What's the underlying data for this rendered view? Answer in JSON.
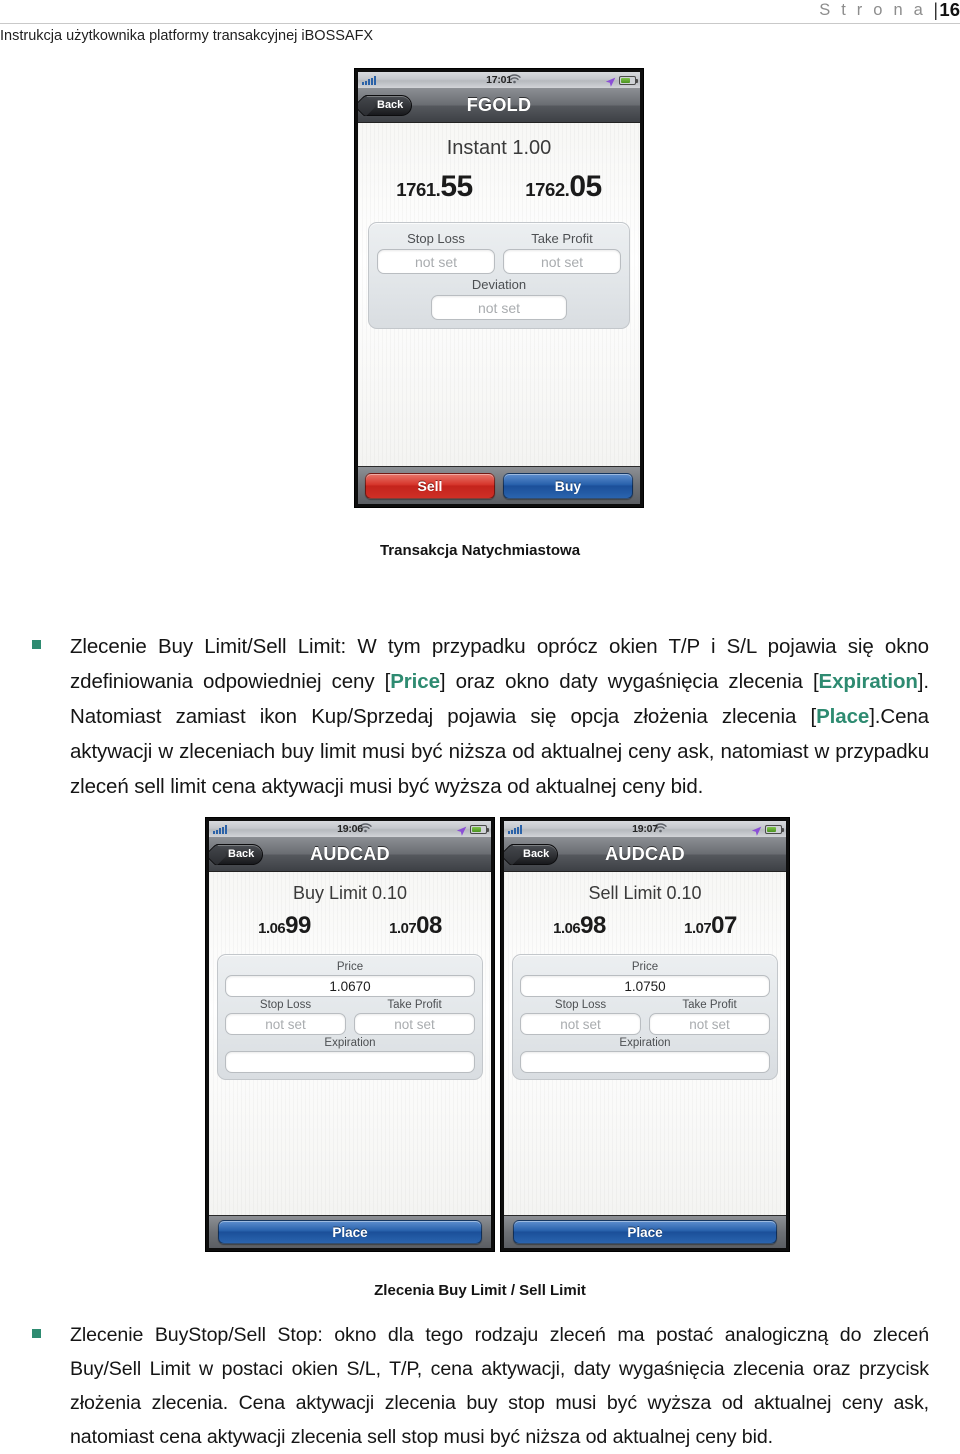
{
  "header": {
    "page_label": "S t r o n a",
    "separator": "|",
    "page_number": "16",
    "document_subtitle": "Instrukcja użytkownika platformy transakcyjnej iBOSSAFX"
  },
  "colors": {
    "accent_green": "#2e8b71",
    "sell_red": "#c4231c",
    "buy_blue": "#1b4f99",
    "signal_blue": "#2b62a8",
    "battery_green": "#4b9321"
  },
  "figure1": {
    "caption": "Transakcja Natychmiastowa",
    "status_bar": {
      "time": "17:01"
    },
    "nav": {
      "back_label": "Back",
      "title": "FGOLD"
    },
    "order_type": "Instant 1.00",
    "bid": {
      "int": "1761.",
      "dec": "55"
    },
    "ask": {
      "int": "1762.",
      "dec": "05"
    },
    "fields": {
      "stop_loss_label": "Stop Loss",
      "stop_loss_value": "not set",
      "take_profit_label": "Take Profit",
      "take_profit_value": "not set",
      "deviation_label": "Deviation",
      "deviation_value": "not set"
    },
    "buttons": {
      "sell": "Sell",
      "buy": "Buy"
    }
  },
  "figure2": {
    "caption": "Zlecenia Buy Limit / Sell Limit",
    "phones": [
      {
        "status_bar": {
          "time": "19:06"
        },
        "nav": {
          "back_label": "Back",
          "title": "AUDCAD"
        },
        "order_type": "Buy Limit 0.10",
        "bid": {
          "int": "1.06",
          "dec": "99"
        },
        "ask": {
          "int": "1.07",
          "dec": "08"
        },
        "fields": {
          "price_label": "Price",
          "price_value": "1.0670",
          "stop_loss_label": "Stop Loss",
          "stop_loss_value": "not set",
          "take_profit_label": "Take Profit",
          "take_profit_value": "not set",
          "expiration_label": "Expiration",
          "expiration_value": ""
        },
        "buttons": {
          "place": "Place"
        }
      },
      {
        "status_bar": {
          "time": "19:07"
        },
        "nav": {
          "back_label": "Back",
          "title": "AUDCAD"
        },
        "order_type": "Sell Limit 0.10",
        "bid": {
          "int": "1.06",
          "dec": "98"
        },
        "ask": {
          "int": "1.07",
          "dec": "07"
        },
        "fields": {
          "price_label": "Price",
          "price_value": "1.0750",
          "stop_loss_label": "Stop Loss",
          "stop_loss_value": "not set",
          "take_profit_label": "Take Profit",
          "take_profit_value": "not set",
          "expiration_label": "Expiration",
          "expiration_value": ""
        },
        "buttons": {
          "place": "Place"
        }
      }
    ]
  },
  "paragraphs": {
    "p1": {
      "seg1": "Zlecenie Buy Limit/Sell Limit: W tym przypadku oprócz okien T/P i S/L pojawia się okno zdefiniowania odpowiedniej ceny [",
      "hl1": "Price",
      "seg2": "] oraz okno daty wygaśnięcia zlecenia [",
      "hl2": "Expiration",
      "seg3": "]. Natomiast  zamiast ikon Kup/Sprzedaj pojawia się opcja złożenia zlecenia [",
      "hl3": "Place",
      "seg4": "].Cena aktywacji w zleceniach buy limit musi być niższa od aktualnej ceny ask, natomiast w przypadku zleceń sell limit cena aktywacji musi być wyższa od aktualnej ceny bid."
    },
    "p2": {
      "text": "Zlecenie BuyStop/Sell Stop: okno dla tego rodzaju zleceń ma postać analogiczną do zleceń Buy/Sell Limit w postaci okien S/L, T/P, cena aktywacji, daty wygaśnięcia zlecenia oraz przycisk złożenia zlecenia. Cena aktywacji zlecenia buy stop musi być wyższa od aktualnej ceny ask, natomiast cena aktywacji zlecenia sell stop musi być niższa od aktualnej ceny bid."
    }
  }
}
